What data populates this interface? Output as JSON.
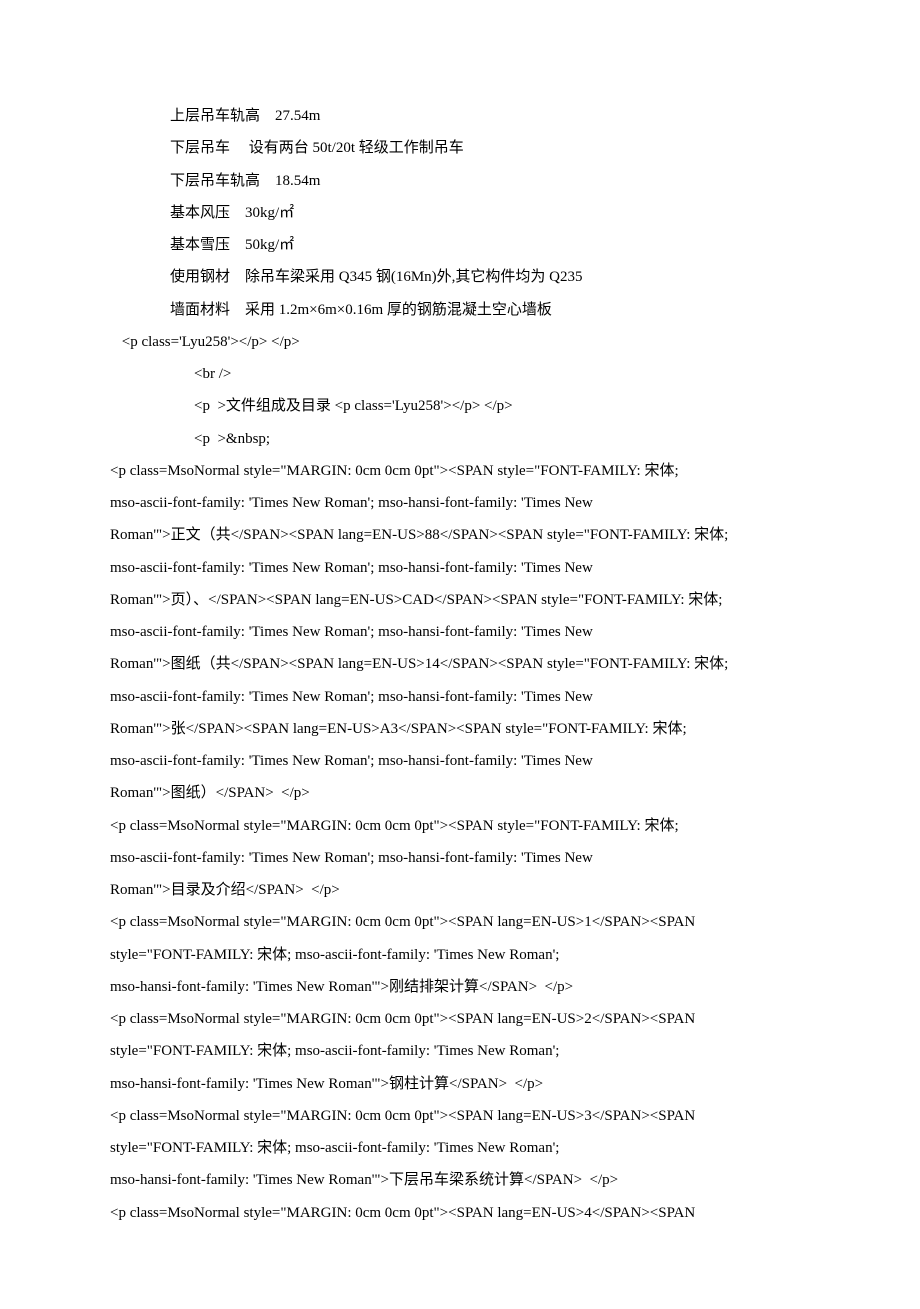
{
  "specs": {
    "l1": "上层吊车轨高    27.54m",
    "l2": "下层吊车     设有两台 50t/20t 轻级工作制吊车",
    "l3": "下层吊车轨高    18.54m",
    "l4": "基本风压    30kg/㎡",
    "l5": "基本雪压    50kg/㎡",
    "l6": "使用钢材    除吊车梁采用 Q345 钢(16Mn)外,其它构件均为 Q235",
    "l7": "墙面材料    采用 1.2m×6m×0.16m 厚的钢筋混凝土空心墙板"
  },
  "raw": {
    "r1": " <p class='Lyu258'></p> </p>",
    "r2": "<br />",
    "r3": "<p  >文件组成及目录 <p class='Lyu258'></p> </p>",
    "r4": "<p  >&nbsp;",
    "r5": "<p class=MsoNormal style=\"MARGIN: 0cm 0cm 0pt\"><SPAN style=\"FONT-FAMILY: 宋体;",
    "r6": "mso-ascii-font-family: 'Times New Roman'; mso-hansi-font-family: 'Times New",
    "r7": "Roman'\">正文（共</SPAN><SPAN lang=EN-US>88</SPAN><SPAN style=\"FONT-FAMILY: 宋体;",
    "r8": "mso-ascii-font-family: 'Times New Roman'; mso-hansi-font-family: 'Times New",
    "r9": "Roman'\">页）、</SPAN><SPAN lang=EN-US>CAD</SPAN><SPAN style=\"FONT-FAMILY: 宋体;",
    "r10": "mso-ascii-font-family: 'Times New Roman'; mso-hansi-font-family: 'Times New",
    "r11": "Roman'\">图纸（共</SPAN><SPAN lang=EN-US>14</SPAN><SPAN style=\"FONT-FAMILY: 宋体;",
    "r12": "mso-ascii-font-family: 'Times New Roman'; mso-hansi-font-family: 'Times New",
    "r13": "Roman'\">张</SPAN><SPAN lang=EN-US>A3</SPAN><SPAN style=\"FONT-FAMILY: 宋体;",
    "r14": "mso-ascii-font-family: 'Times New Roman'; mso-hansi-font-family: 'Times New",
    "r15": "Roman'\">图纸）</SPAN>  </p>",
    "r16": "<p class=MsoNormal style=\"MARGIN: 0cm 0cm 0pt\"><SPAN style=\"FONT-FAMILY: 宋体;",
    "r17": "mso-ascii-font-family: 'Times New Roman'; mso-hansi-font-family: 'Times New",
    "r18": "Roman'\">目录及介绍</SPAN>  </p>",
    "r19": "<p class=MsoNormal style=\"MARGIN: 0cm 0cm 0pt\"><SPAN lang=EN-US>1</SPAN><SPAN",
    "r20": "style=\"FONT-FAMILY: 宋体; mso-ascii-font-family: 'Times New Roman';",
    "r21": "mso-hansi-font-family: 'Times New Roman'\">刚结排架计算</SPAN>  </p>",
    "r22": "<p class=MsoNormal style=\"MARGIN: 0cm 0cm 0pt\"><SPAN lang=EN-US>2</SPAN><SPAN",
    "r23": "style=\"FONT-FAMILY: 宋体; mso-ascii-font-family: 'Times New Roman';",
    "r24": "mso-hansi-font-family: 'Times New Roman'\">钢柱计算</SPAN>  </p>",
    "r25": "<p class=MsoNormal style=\"MARGIN: 0cm 0cm 0pt\"><SPAN lang=EN-US>3</SPAN><SPAN",
    "r26": "style=\"FONT-FAMILY: 宋体; mso-ascii-font-family: 'Times New Roman';",
    "r27": "mso-hansi-font-family: 'Times New Roman'\">下层吊车梁系统计算</SPAN>  </p>",
    "r28": "<p class=MsoNormal style=\"MARGIN: 0cm 0cm 0pt\"><SPAN lang=EN-US>4</SPAN><SPAN"
  }
}
